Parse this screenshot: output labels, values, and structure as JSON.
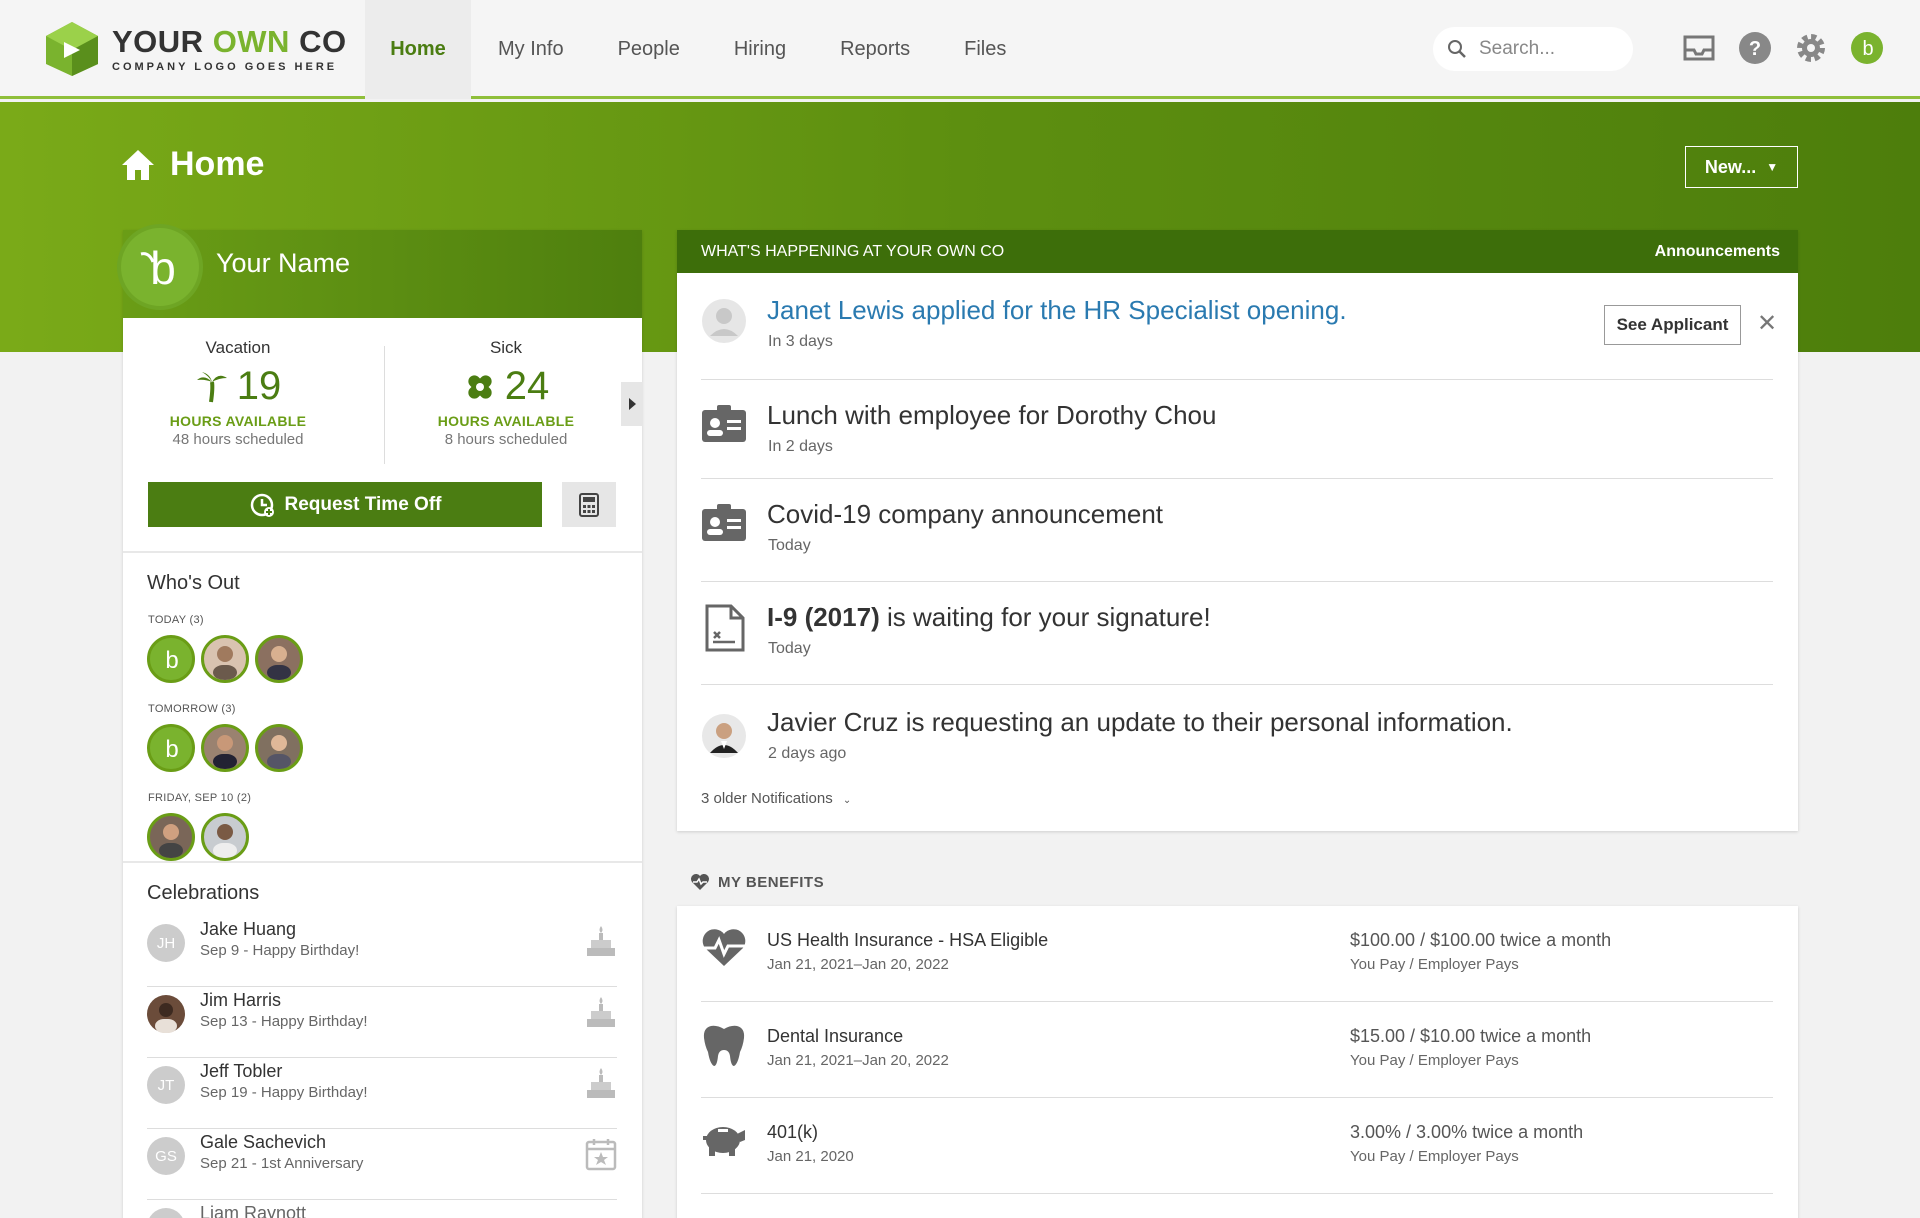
{
  "brand": {
    "name_part1": "YOUR ",
    "name_part2": "OWN",
    "name_part3": " CO",
    "tagline": "COMPANY LOGO GOES HERE",
    "accent": "#7ab32e",
    "dark_green": "#4b7d12"
  },
  "nav": {
    "tabs": [
      "Home",
      "My Info",
      "People",
      "Hiring",
      "Reports",
      "Files"
    ],
    "active": "Home"
  },
  "search": {
    "placeholder": "Search..."
  },
  "page": {
    "title": "Home",
    "new_button": "New..."
  },
  "profile": {
    "name": "Your Name",
    "balances": [
      {
        "type": "Vacation",
        "hours": "19",
        "units": "HOURS AVAILABLE",
        "scheduled": "48 hours scheduled",
        "icon": "palm-tree-icon"
      },
      {
        "type": "Sick",
        "hours": "24",
        "units": "HOURS AVAILABLE",
        "scheduled": "8 hours scheduled",
        "icon": "bandage-icon"
      }
    ],
    "request_button": "Request Time Off"
  },
  "whos_out": {
    "title": "Who's Out",
    "groups": [
      {
        "label": "TODAY (3)"
      },
      {
        "label": "TOMORROW (3)"
      },
      {
        "label": "FRIDAY, SEP 10 (2)"
      }
    ]
  },
  "celebrations": {
    "title": "Celebrations",
    "items": [
      {
        "initials": "JH",
        "name": "Jake Huang",
        "detail": "Sep 9 - Happy Birthday!"
      },
      {
        "initials": "",
        "name": "Jim Harris",
        "detail": "Sep 13 - Happy Birthday!"
      },
      {
        "initials": "JT",
        "name": "Jeff Tobler",
        "detail": "Sep 19 - Happy Birthday!"
      },
      {
        "initials": "GS",
        "name": "Gale Sachevich",
        "detail": "Sep 21 - 1st Anniversary"
      },
      {
        "initials": "",
        "name": "Liam Raynott",
        "detail": ""
      }
    ]
  },
  "happening": {
    "header": "WHAT'S HAPPENING AT YOUR OWN CO",
    "link": "Announcements",
    "notifications": [
      {
        "title": "Janet Lewis applied for the HR Specialist opening.",
        "sub": "In 3 days",
        "action": "See Applicant"
      },
      {
        "title": "Lunch with employee for Dorothy Chou",
        "sub": "In 2 days"
      },
      {
        "title": "Covid-19 company announcement",
        "sub": "Today"
      },
      {
        "title_bold": "I-9 (2017)",
        "title_rest": " is waiting for your signature!",
        "sub": "Today"
      },
      {
        "title": "Javier Cruz is requesting an update to their personal information.",
        "sub": "2 days ago"
      }
    ],
    "older": "3 older Notifications"
  },
  "benefits": {
    "title": "MY BENEFITS",
    "items": [
      {
        "name": "US Health Insurance - HSA Eligible",
        "dates": "Jan 21, 2021–Jan 20, 2022",
        "amount": "$100.00 / $100.00 twice a month",
        "payers": "You Pay / Employer Pays"
      },
      {
        "name": "Dental Insurance",
        "dates": "Jan 21, 2021–Jan 20, 2022",
        "amount": "$15.00 / $10.00 twice a month",
        "payers": "You Pay / Employer Pays"
      },
      {
        "name": "401(k)",
        "dates": "Jan 21, 2020",
        "amount": "3.00% / 3.00% twice a month",
        "payers": "You Pay / Employer Pays"
      }
    ]
  }
}
